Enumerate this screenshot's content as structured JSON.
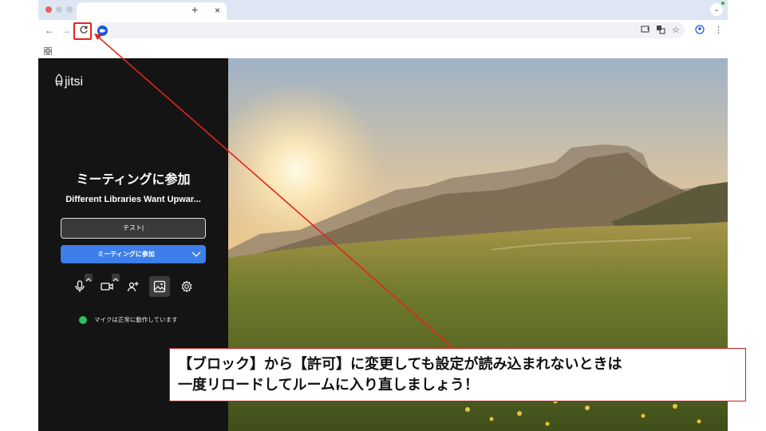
{
  "browser": {
    "tab_title": "",
    "tab_close": "×",
    "new_tab": "+",
    "colors": {
      "tab_strip": "#dfe6f3",
      "omnibox": "#f0f2f6",
      "camera_badge": "#1a57d6"
    }
  },
  "jitsi": {
    "logo_text": "jitsi",
    "prejoin_title": "ミーティングに参加",
    "meeting_subject": "Different Libraries Want Upwar...",
    "name_value": "テスト",
    "join_button": "ミーティングに参加",
    "mic_status": "マイクは正常に動作しています",
    "colors": {
      "sidebar": "#141414",
      "join_button": "#3d7ee8",
      "status_ok": "#2fbf5c"
    }
  },
  "annotation": {
    "line1": "【ブロック】から【許可】に変更しても設定が読み込まれないときは",
    "line2": "一度リロードしてルームに入り直しましょう！",
    "color": "#e4241b"
  }
}
